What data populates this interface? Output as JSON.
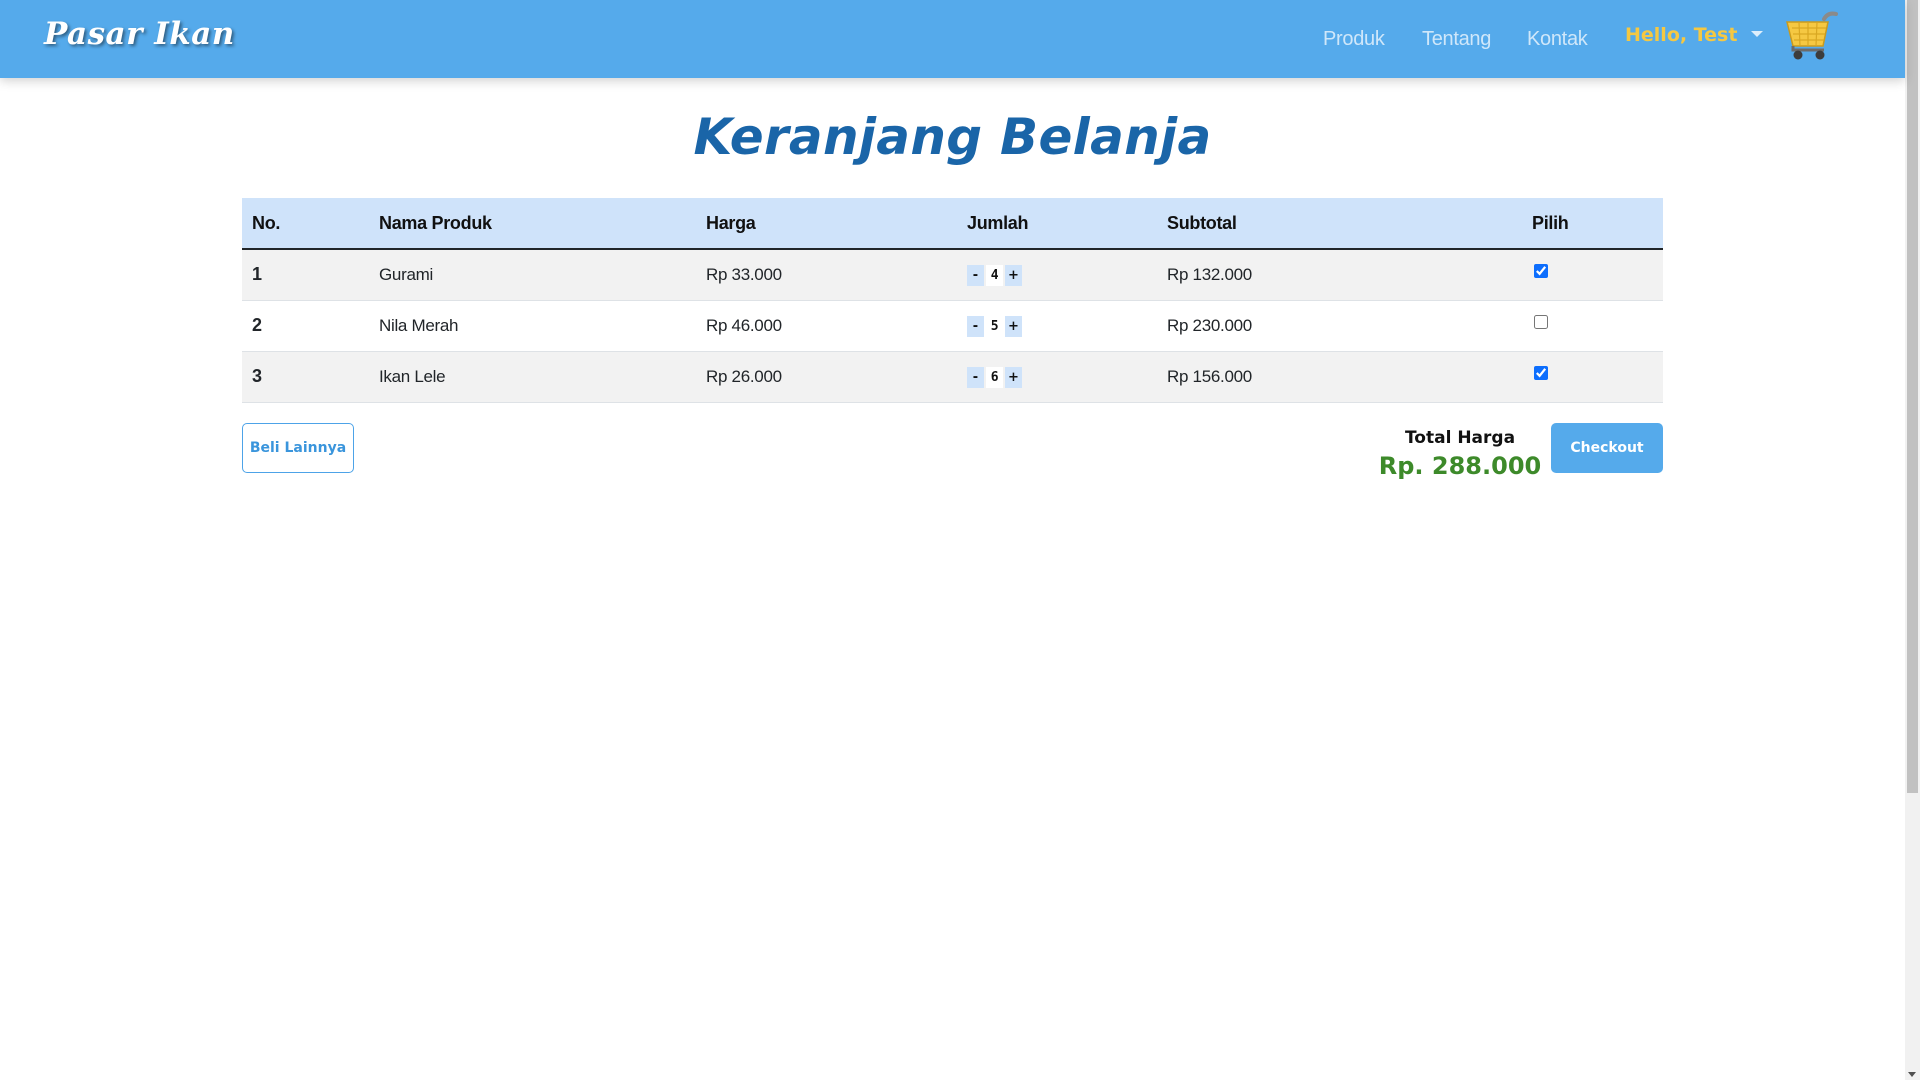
{
  "navbar": {
    "brand": "Pasar Ikan",
    "links": [
      "Produk",
      "Tentang",
      "Kontak"
    ],
    "user_label": "Hello, Test",
    "cart_icon": "shopping-cart-icon",
    "colors": {
      "bar": "#55aaeb",
      "user": "#f5c842"
    }
  },
  "page": {
    "title": "Keranjang Belanja"
  },
  "table": {
    "headers": [
      "No.",
      "Nama Produk",
      "Harga",
      "Jumlah",
      "Subtotal",
      "Pilih"
    ],
    "rows": [
      {
        "no": "1",
        "name": "Gurami",
        "price": "Rp 33.000",
        "qty": "4",
        "subtotal": "Rp 132.000",
        "selected": true
      },
      {
        "no": "2",
        "name": "Nila Merah",
        "price": "Rp 46.000",
        "qty": "5",
        "subtotal": "Rp 230.000",
        "selected": false
      },
      {
        "no": "3",
        "name": "Ikan Lele",
        "price": "Rp 26.000",
        "qty": "6",
        "subtotal": "Rp 156.000",
        "selected": true
      }
    ],
    "qty_minus": "-",
    "qty_plus": "+"
  },
  "actions": {
    "buy_more": "Beli Lainnya",
    "total_label": "Total Harga",
    "total_value": "Rp. 288.000",
    "checkout": "Checkout"
  }
}
